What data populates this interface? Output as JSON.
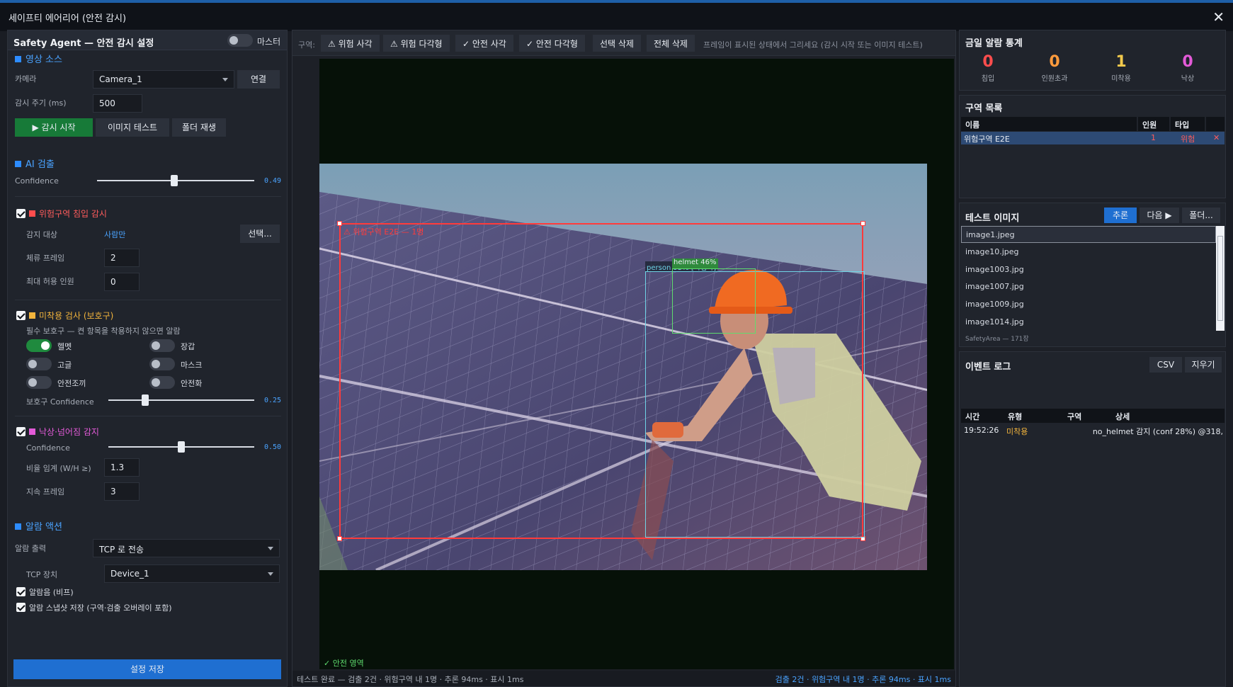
{
  "window": {
    "title": "세이프티 에어리어 (안전 감시)",
    "close": "✕"
  },
  "left": {
    "header": "Safety Agent — 안전 감시 설정",
    "master_label": "마스터",
    "video_source": {
      "section": "영상 소스",
      "camera_label": "카메라",
      "camera_value": "Camera_1",
      "connect": "연결",
      "interval_label": "감시 주기 (ms)",
      "interval_value": "500",
      "start": "▶ 감시 시작",
      "image_test": "이미지 테스트",
      "folder_play": "폴더 재생"
    },
    "ai": {
      "section": "AI 검출",
      "confidence_label": "Confidence",
      "confidence_value": "0.49",
      "confidence": 0.49
    },
    "zone": {
      "title": "위험구역 침입 감시",
      "target_label": "감지 대상",
      "target_value": "사람만",
      "select": "선택...",
      "stay_label": "체류 프레임",
      "stay_value": "2",
      "max_label": "최대 허용 인원",
      "max_value": "0"
    },
    "ppe": {
      "title": "미착용 검사 (보호구)",
      "desc": "필수 보호구 — 켠 항목을 착용하지 않으면 알람",
      "items": [
        "헬멧",
        "장갑",
        "고글",
        "마스크",
        "안전조끼",
        "안전화"
      ],
      "enabled": [
        true,
        false,
        false,
        false,
        false,
        false
      ],
      "confidence_label": "보호구 Confidence",
      "confidence_value": "0.25",
      "confidence": 0.25
    },
    "fall": {
      "title": "낙상·넘어짐 감지",
      "confidence_label": "Confidence",
      "confidence_value": "0.50",
      "confidence": 0.5,
      "ratio_label": "비율 임계 (W/H ≥)",
      "ratio_value": "1.3",
      "frames_label": "지속 프레임",
      "frames_value": "3"
    },
    "alarm": {
      "section": "알람 액션",
      "output_label": "알람 출력",
      "output_value": "TCP 로 전송",
      "tcp_label": "TCP 장치",
      "tcp_value": "Device_1",
      "beep": "알람음 (비프)",
      "snapshot": "알람 스냅샷 저장 (구역·검출 오버레이 포함)"
    },
    "save": "설정 저장"
  },
  "center": {
    "zone_label": "구역:",
    "tools": [
      "⚠ 위험 사각",
      "⚠ 위험 다각형",
      "✓ 안전 사각",
      "✓ 안전 다각형",
      "선택 삭제",
      "전체 삭제"
    ],
    "hint": "프레임이 표시된 상태에서 그리세요 (감시 시작 또는 이미지 테스트)",
    "zone_box_label": "⚠ 위험구역 E2E — 1명",
    "person_label": "person 95% [작업자]",
    "helmet_label": "helmet 46%",
    "safe_zone_label": "✓ 안전 영역",
    "status_left": "테스트 완료 — 검출 2건 · 위험구역 내 1명 · 추론 94ms · 표시 1ms",
    "status_right": "검출 2건 · 위험구역 내 1명 · 추론 94ms · 표시 1ms"
  },
  "right": {
    "stats": {
      "title": "금일 알람 통계",
      "items": [
        {
          "n": "0",
          "c": "침입",
          "color": "#ff4d4d"
        },
        {
          "n": "0",
          "c": "인원초과",
          "color": "#ff9b3d"
        },
        {
          "n": "1",
          "c": "미착용",
          "color": "#f2c94c"
        },
        {
          "n": "0",
          "c": "낙상",
          "color": "#e35ad8"
        }
      ]
    },
    "zones": {
      "title": "구역 목록",
      "cols": [
        "이름",
        "인원",
        "타입"
      ],
      "row": {
        "name": "위험구역 E2E",
        "count": "1",
        "type": "위험",
        "del": "✕"
      }
    },
    "test_images": {
      "title": "테스트 이미지",
      "infer": "추론",
      "next": "다음 ▶",
      "folder": "폴더...",
      "files": [
        "image1.jpeg",
        "image10.jpeg",
        "image1003.jpg",
        "image1007.jpg",
        "image1009.jpg",
        "image1014.jpg"
      ],
      "footer": "SafetyArea — 171장"
    },
    "events": {
      "title": "이벤트 로그",
      "csv": "CSV",
      "clear": "지우기",
      "cols": [
        "시간",
        "유형",
        "구역",
        "상세"
      ],
      "row": {
        "time": "19:52:26",
        "type": "미착용",
        "zone": "",
        "detail": "no_helmet 감지 (conf 28%) @318,"
      }
    }
  }
}
